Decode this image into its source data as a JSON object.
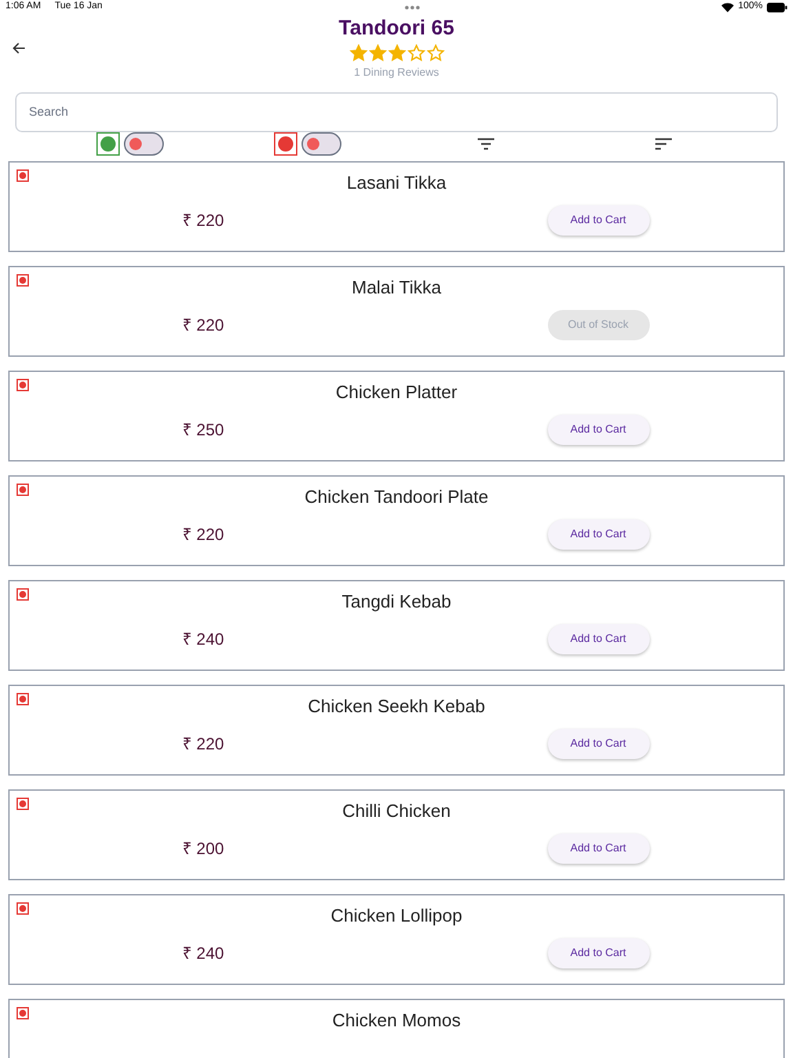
{
  "status_bar": {
    "time": "1:06 AM",
    "date": "Tue 16 Jan",
    "battery": "100%"
  },
  "header": {
    "title": "Tandoori 65",
    "stars": 3,
    "reviews": "1 Dining Reviews"
  },
  "search": {
    "placeholder": "Search"
  },
  "filters": [
    {
      "kind": "veg",
      "on": false
    },
    {
      "kind": "nonveg",
      "on": false
    }
  ],
  "items": [
    {
      "name": "Lasani Tikka",
      "price": "₹ 220",
      "kind": "nonveg",
      "in_stock": true,
      "action": "Add to Cart"
    },
    {
      "name": "Malai Tikka",
      "price": "₹ 220",
      "kind": "nonveg",
      "in_stock": false,
      "action": "Out of Stock"
    },
    {
      "name": "Chicken Platter",
      "price": "₹ 250",
      "kind": "nonveg",
      "in_stock": true,
      "action": "Add to Cart"
    },
    {
      "name": "Chicken Tandoori Plate",
      "price": "₹ 220",
      "kind": "nonveg",
      "in_stock": true,
      "action": "Add to Cart"
    },
    {
      "name": "Tangdi Kebab",
      "price": "₹ 240",
      "kind": "nonveg",
      "in_stock": true,
      "action": "Add to Cart"
    },
    {
      "name": "Chicken Seekh Kebab",
      "price": "₹ 220",
      "kind": "nonveg",
      "in_stock": true,
      "action": "Add to Cart"
    },
    {
      "name": "Chilli Chicken",
      "price": "₹ 200",
      "kind": "nonveg",
      "in_stock": true,
      "action": "Add to Cart"
    },
    {
      "name": "Chicken Lollipop",
      "price": "₹ 240",
      "kind": "nonveg",
      "in_stock": true,
      "action": "Add to Cart"
    },
    {
      "name": "Chicken Momos",
      "kind": "nonveg"
    }
  ]
}
